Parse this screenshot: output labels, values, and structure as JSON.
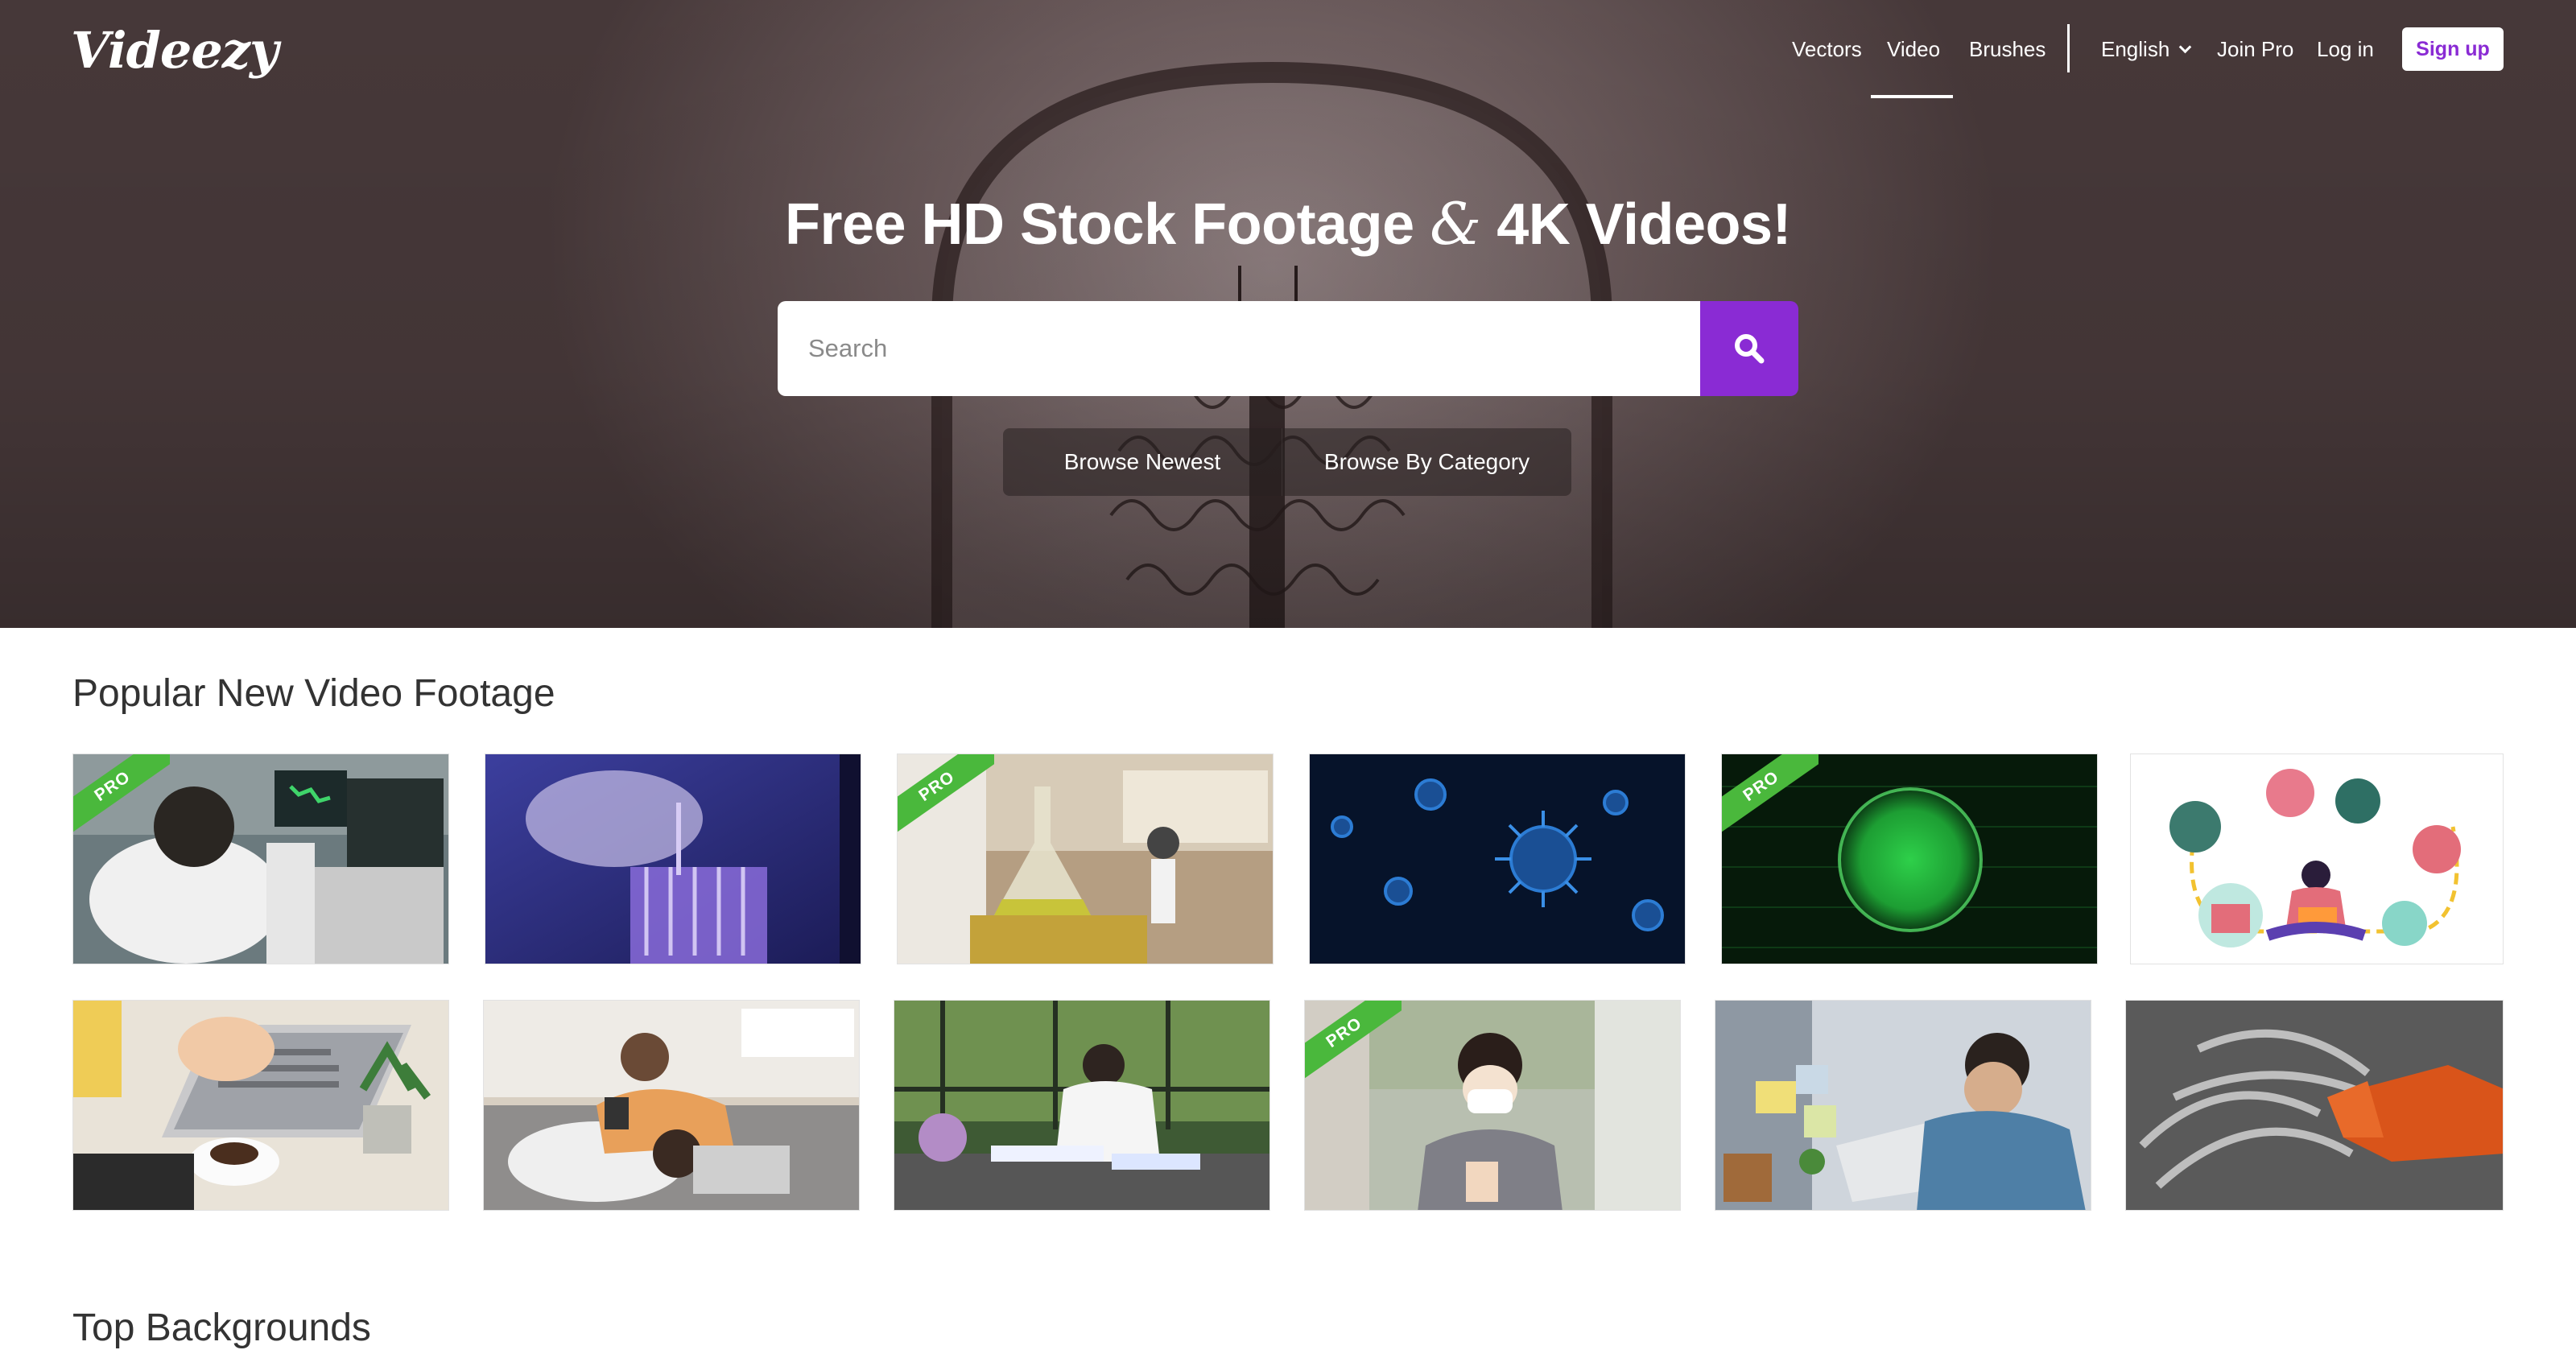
{
  "brand": {
    "logo_text": "Videezy",
    "accent_color": "#8a2bd4",
    "pro_color": "#4ab83c"
  },
  "nav": {
    "links": [
      {
        "label": "Vectors"
      },
      {
        "label": "Video",
        "active": true
      },
      {
        "label": "Brushes"
      }
    ],
    "language": "English",
    "join_pro": "Join Pro",
    "login": "Log in",
    "signup": "Sign up"
  },
  "hero": {
    "title_part1": "Free HD Stock Footage ",
    "title_amp": "&",
    "title_part2": " 4K Videos!",
    "search_placeholder": "Search",
    "search_icon": "search-icon",
    "browse_newest": "Browse Newest",
    "browse_category": "Browse By Category"
  },
  "sections": {
    "popular_title": "Popular New Video Footage",
    "backgrounds_title": "Top Backgrounds"
  },
  "thumbnails": [
    {
      "subject": "scientist-microscope",
      "pro": true,
      "badge": "PRO"
    },
    {
      "subject": "lab-vials-purple",
      "pro": false
    },
    {
      "subject": "lab-flask",
      "pro": true,
      "badge": "PRO"
    },
    {
      "subject": "blue-virus",
      "pro": false
    },
    {
      "subject": "green-cell",
      "pro": true,
      "badge": "PRO"
    },
    {
      "subject": "ecommerce-illustration",
      "pro": false
    },
    {
      "subject": "laptop-coffee-desk",
      "pro": false
    },
    {
      "subject": "couple-sofa",
      "pro": false
    },
    {
      "subject": "woman-coffee-table",
      "pro": false
    },
    {
      "subject": "masked-woman-thumbs-up",
      "pro": true,
      "badge": "PRO"
    },
    {
      "subject": "tired-man-laptop",
      "pro": false
    },
    {
      "subject": "glove-cleaning-surface",
      "pro": false
    }
  ]
}
